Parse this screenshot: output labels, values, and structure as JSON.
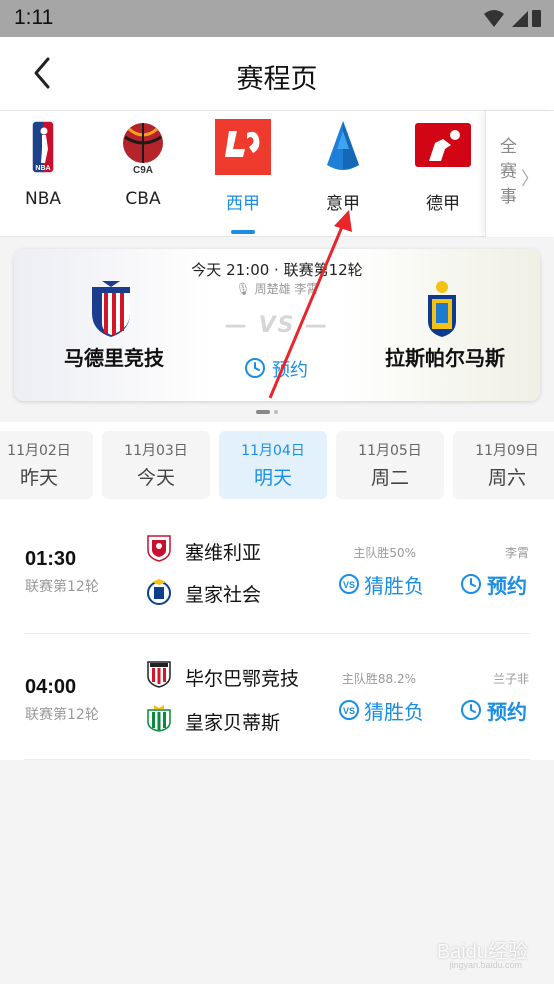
{
  "status_bar": {
    "time": "1:11"
  },
  "header": {
    "title": "赛程页"
  },
  "leagues": [
    {
      "name": "NBA",
      "icon": "nba-logo"
    },
    {
      "name": "CBA",
      "icon": "cba-logo"
    },
    {
      "name": "西甲",
      "icon": "laliga-logo",
      "active": true
    },
    {
      "name": "意甲",
      "icon": "serie-a-logo"
    },
    {
      "name": "德甲",
      "icon": "bundesliga-logo"
    }
  ],
  "all_events": {
    "chars": [
      "全",
      "赛",
      "事"
    ]
  },
  "featured": {
    "time": "今天 21:00 · 联赛第12轮",
    "anchor": "周楚雄 李霄",
    "vs": "VS",
    "home": "马德里竞技",
    "away": "拉斯帕尔马斯",
    "reserve_label": "预约"
  },
  "dates": [
    {
      "date": "11月02日",
      "weekday": "昨天"
    },
    {
      "date": "11月03日",
      "weekday": "今天"
    },
    {
      "date": "11月04日",
      "weekday": "明天",
      "active": true
    },
    {
      "date": "11月05日",
      "weekday": "周二"
    },
    {
      "date": "11月09日",
      "weekday": "周六"
    }
  ],
  "matches": [
    {
      "time": "01:30",
      "round": "联赛第12轮",
      "home": "塞维利亚",
      "away": "皇家社会",
      "stat": "主队胜50%",
      "guess_label": "猜胜负",
      "expert": "李霄",
      "reserve_label": "预约"
    },
    {
      "time": "04:00",
      "round": "联赛第12轮",
      "home": "毕尔巴鄂竞技",
      "away": "皇家贝蒂斯",
      "stat": "主队胜88.2%",
      "guess_label": "猜胜负",
      "expert": "兰子非",
      "reserve_label": "预约"
    }
  ],
  "watermark": {
    "text": "Baidu经验",
    "sub": "jingyan.baidu.com"
  },
  "colors": {
    "accent": "#1a8ee6",
    "annotation_arrow": "#e8262b"
  }
}
